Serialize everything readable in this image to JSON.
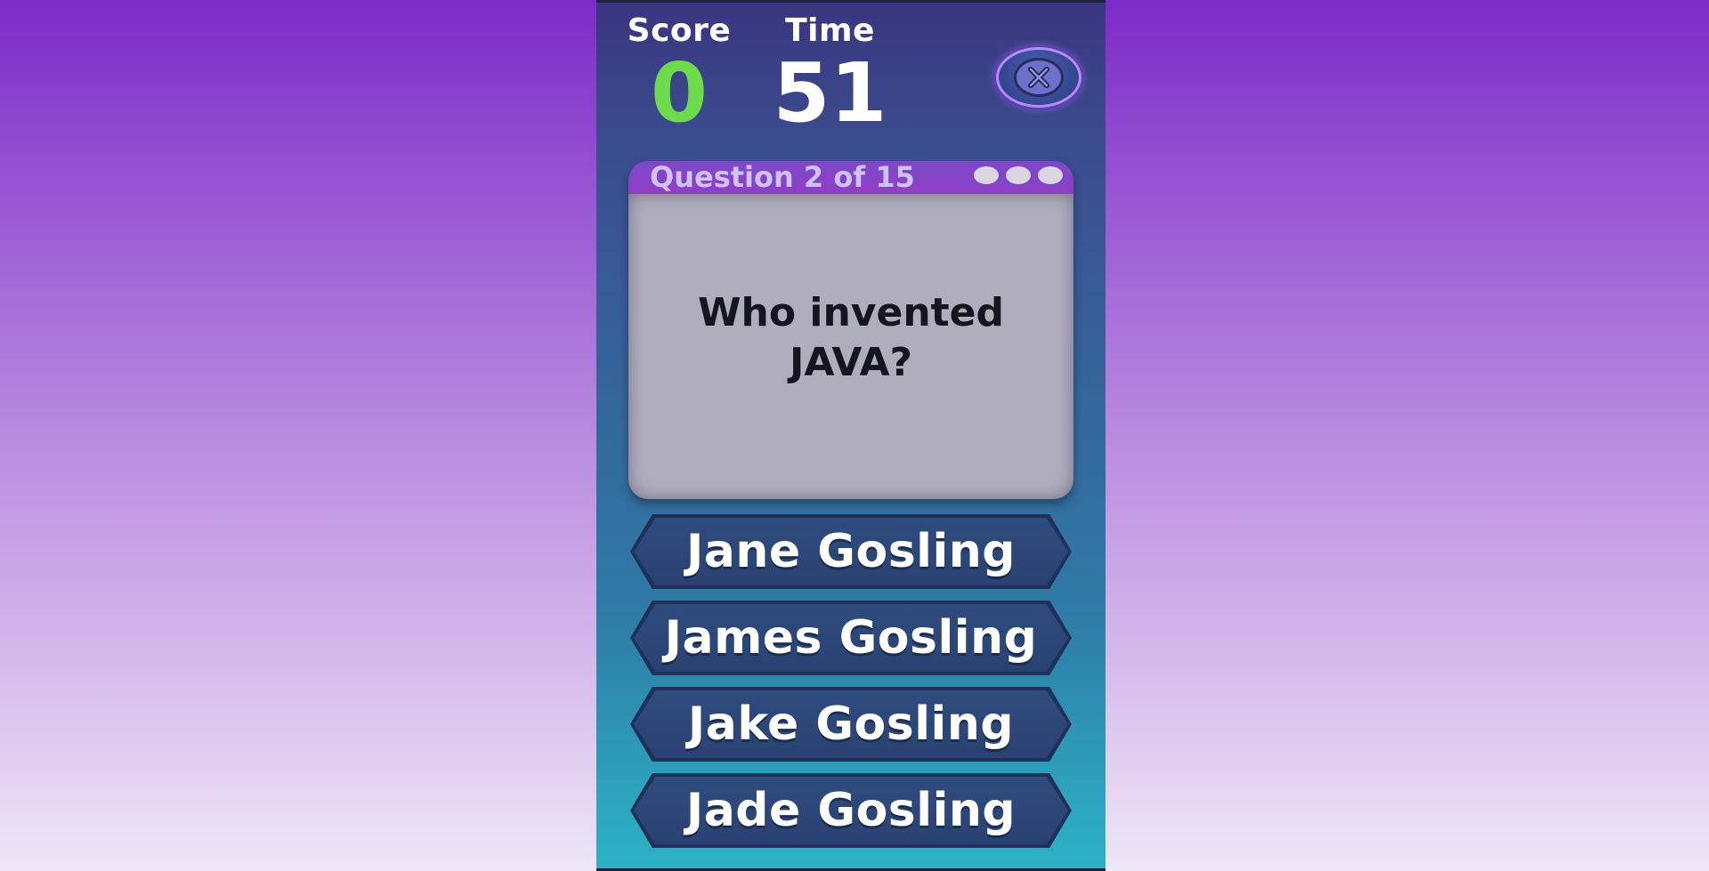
{
  "hud": {
    "score_label": "Score",
    "score_value": "0",
    "time_label": "Time",
    "time_value": "51",
    "close_icon": "close-x-icon"
  },
  "question": {
    "header": "Question 2 of 15",
    "text": "Who invented JAVA?"
  },
  "answers": [
    {
      "label": "Jane Gosling"
    },
    {
      "label": "James Gosling"
    },
    {
      "label": "Jake Gosling"
    },
    {
      "label": "Jade Gosling"
    }
  ],
  "colors": {
    "score_value": "#6edb4c",
    "header_bar": "#8f3ec6",
    "card_body": "#b0aebd",
    "answer_button": "#2f4b7e"
  }
}
